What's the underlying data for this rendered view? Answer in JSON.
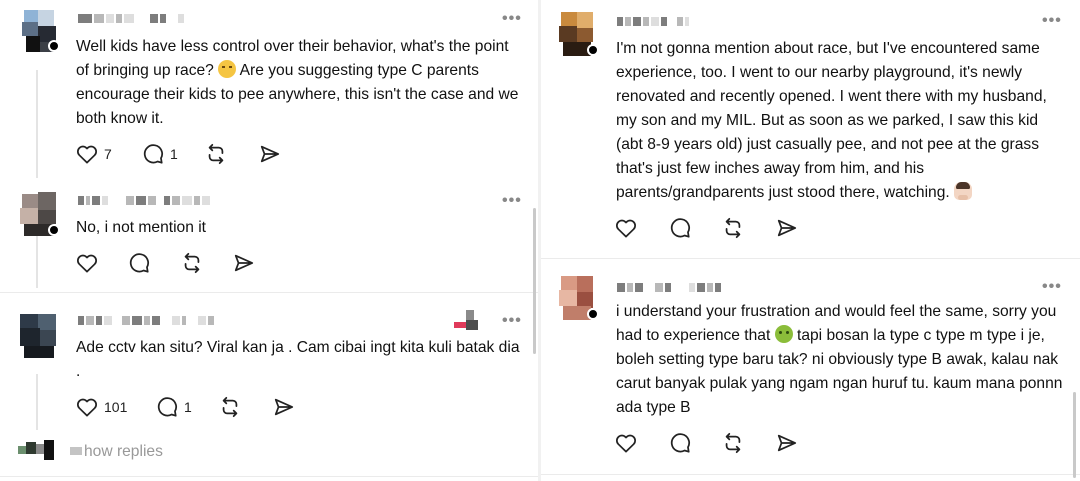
{
  "left": {
    "posts": [
      {
        "body_parts": [
          "Well kids have less control over their behavior, what's the point of bringing up race? ",
          " Are you suggesting type C parents encourage their kids to pee anywhere, this isn't the case and we both know it."
        ],
        "emoji": "disappointed-face",
        "likes": "7",
        "replies": "1"
      },
      {
        "body": "No,  i not mention it",
        "likes": "",
        "replies": ""
      },
      {
        "body": "Ade cctv kan situ?  Viral kan ja .  Cam cibai  ingt kita kuli batak dia .",
        "likes": "101",
        "replies": "1"
      }
    ],
    "show_replies": "how replies"
  },
  "right": {
    "posts": [
      {
        "body_parts": [
          "I'm not gonna mention about race, but I've encountered same experience, too. I went to our nearby playground, it's newly renovated and recently opened. I went there with my husband, my son and my MIL. But as soon as we parked, I saw this kid (abt 8-9 years old) just casually pee, and not pee at the grass that's just few inches away from him, and his parents/grandparents just stood there, watching. ",
          ""
        ],
        "emoji": "woman-facepalming"
      },
      {
        "body_parts": [
          "i understand your frustration and would feel the same, sorry you had to experience that ",
          " tapi bosan la type c type m type i je, boleh setting type baru tak? ni obviously type B awak, kalau nak carut banyak pulak yang ngam ngan huruf tu. kaum mana ponnn ada type B"
        ],
        "emoji": "nauseated-face"
      }
    ]
  },
  "colors": {
    "text": "#111111",
    "icon": "#222222",
    "muted": "#999999",
    "divider": "#ebebeb"
  },
  "icons": [
    "heart-icon",
    "comment-icon",
    "repost-icon",
    "share-icon",
    "more-icon"
  ]
}
